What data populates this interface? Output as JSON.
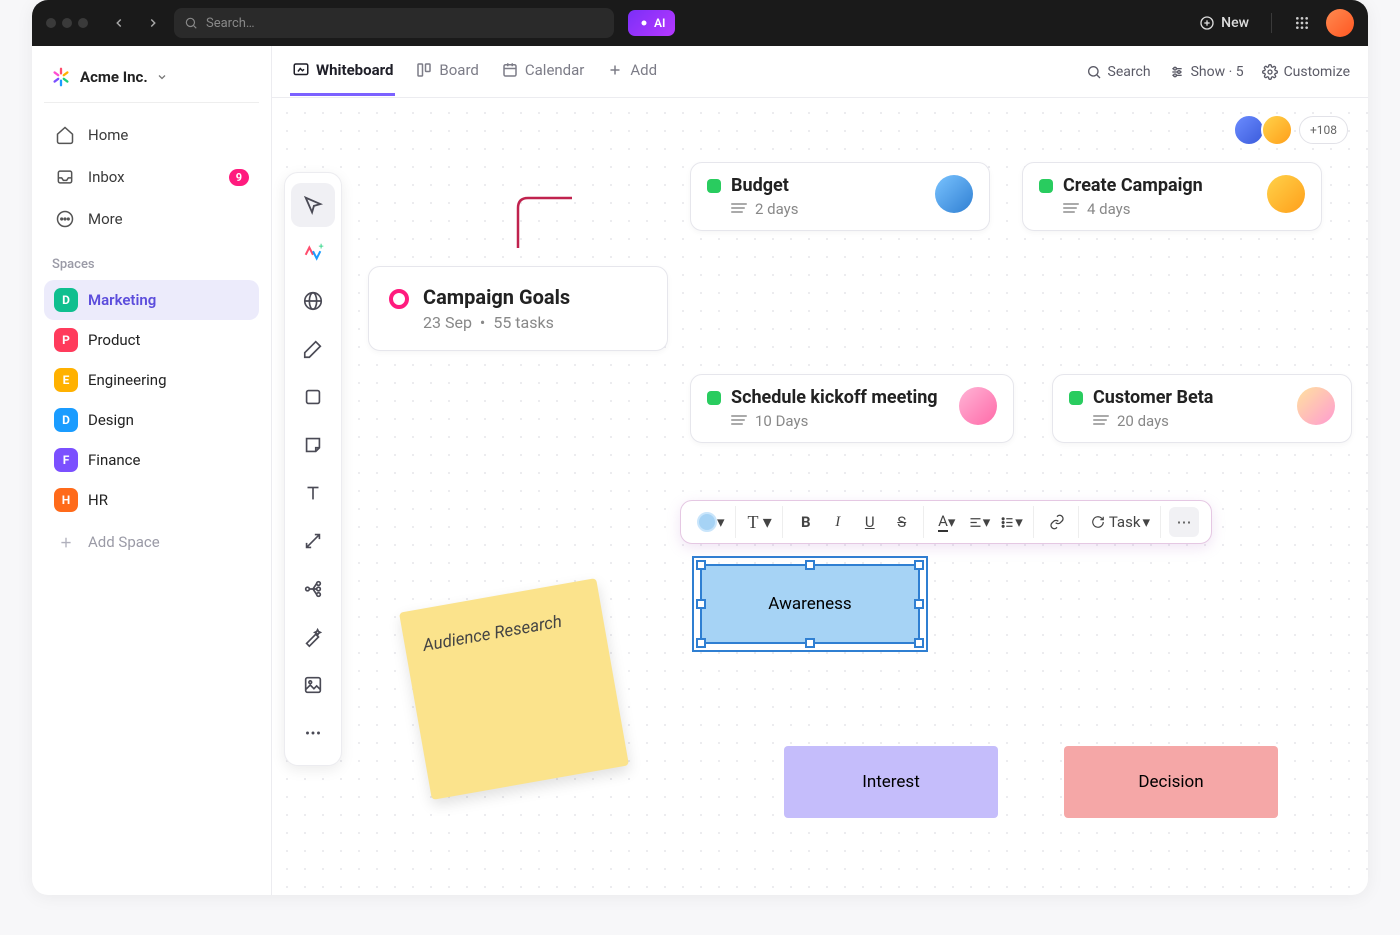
{
  "topbar": {
    "search_placeholder": "Search…",
    "ai_label": "AI",
    "new_label": "New"
  },
  "workspace": {
    "name": "Acme Inc."
  },
  "sidebar": {
    "home": "Home",
    "inbox": "Inbox",
    "inbox_count": "9",
    "more": "More",
    "spaces_label": "Spaces",
    "add_space": "Add Space",
    "spaces": [
      {
        "letter": "D",
        "label": "Marketing",
        "color": "#0fbf8f",
        "active": true
      },
      {
        "letter": "P",
        "label": "Product",
        "color": "#ff3b5c"
      },
      {
        "letter": "E",
        "label": "Engineering",
        "color": "#ffb100"
      },
      {
        "letter": "D",
        "label": "Design",
        "color": "#1a9cff"
      },
      {
        "letter": "F",
        "label": "Finance",
        "color": "#7b50ff"
      },
      {
        "letter": "H",
        "label": "HR",
        "color": "#ff6a1a"
      }
    ]
  },
  "tabs": {
    "whiteboard": "Whiteboard",
    "board": "Board",
    "calendar": "Calendar",
    "add": "Add",
    "search": "Search",
    "show": "Show · 5",
    "customize": "Customize"
  },
  "collab": {
    "more": "+108"
  },
  "cards": {
    "goals": {
      "title": "Campaign Goals",
      "date": "23 Sep",
      "tasks": "55 tasks"
    },
    "budget": {
      "title": "Budget",
      "sub": "2 days"
    },
    "create": {
      "title": "Create Campaign",
      "sub": "4 days"
    },
    "kickoff": {
      "title": "Schedule kickoff meeting",
      "sub": "10 Days"
    },
    "beta": {
      "title": "Customer Beta",
      "sub": "20 days"
    }
  },
  "sticky": {
    "text": "Audience Research"
  },
  "shapes": {
    "awareness": "Awareness",
    "interest": "Interest",
    "decision": "Decision"
  },
  "fmt": {
    "task": "Task"
  }
}
